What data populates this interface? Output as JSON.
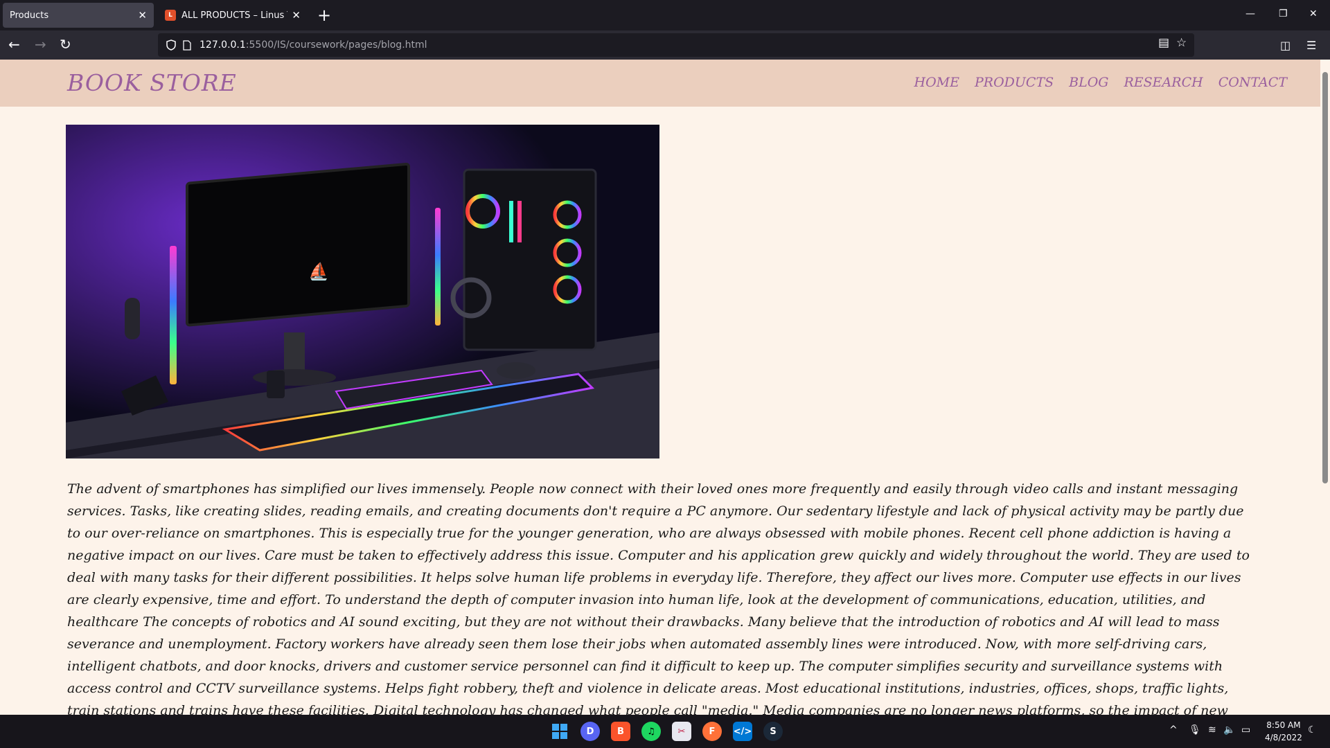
{
  "browser": {
    "tabs": [
      {
        "title": "Products",
        "active": true
      },
      {
        "title": "ALL PRODUCTS – Linus Tech Tips",
        "active": false
      }
    ],
    "url_host": "127.0.0.1",
    "url_path": ":5500/IS/coursework/pages/blog.html"
  },
  "site": {
    "logo": "BOOK STORE",
    "nav": [
      "HOME",
      "PRODUCTS",
      "BLOG",
      "RESEARCH",
      "CONTACT"
    ],
    "hero_image": "pc-gaming-setup",
    "article_text": "The advent of smartphones has simplified our lives immensely. People now connect with their loved ones more frequently and easily through video calls and instant messaging services. Tasks, like creating slides, reading emails, and creating documents don't require a PC anymore. Our sedentary lifestyle and lack of physical activity may be partly due to our over-reliance on smartphones. This is especially true for the younger generation, who are always obsessed with mobile phones. Recent cell phone addiction is having a negative impact on our lives. Care must be taken to effectively address this issue. Computer and his application grew quickly and widely throughout the world. They are used to deal with many tasks for their different possibilities. It helps solve human life problems in everyday life. Therefore, they affect our lives more. Computer use effects in our lives are clearly expensive, time and effort. To understand the depth of computer invasion into human life, look at the development of communications, education, utilities, and healthcare The concepts of robotics and AI sound exciting, but they are not without their drawbacks. Many believe that the introduction of robotics and AI will lead to mass severance and unemployment. Factory workers have already seen them lose their jobs when automated assembly lines were introduced. Now, with more self-driving cars, intelligent chatbots, and door knocks, drivers and customer service personnel can find it difficult to keep up. The computer simplifies security and surveillance systems with access control and CCTV surveillance systems. Helps fight robbery, theft and violence in delicate areas. Most educational institutions, industries, offices, shops, traffic lights, train stations and trains have these facilities. Digital technology has changed what people call \"media.\" Media companies are no longer news platforms, so the impact of new technologies on the media is clear. Today's media companies are any business that helps spread information around the world, including social media platforms such as Facebook and Twitter. It is undeniable that the future of technology will continue to revolutionize our lives. In the next few years, self-driving cars could"
  },
  "taskbar": {
    "apps": [
      "windows-start",
      "discord",
      "brave",
      "spotify",
      "snipping-tool",
      "firefox",
      "vscode",
      "steam"
    ],
    "time": "8:50 AM",
    "date": "4/8/2022"
  },
  "colors": {
    "header_bg": "#ebcfbe",
    "page_bg": "#fdf3ea",
    "brand": "#9a5f9e"
  }
}
